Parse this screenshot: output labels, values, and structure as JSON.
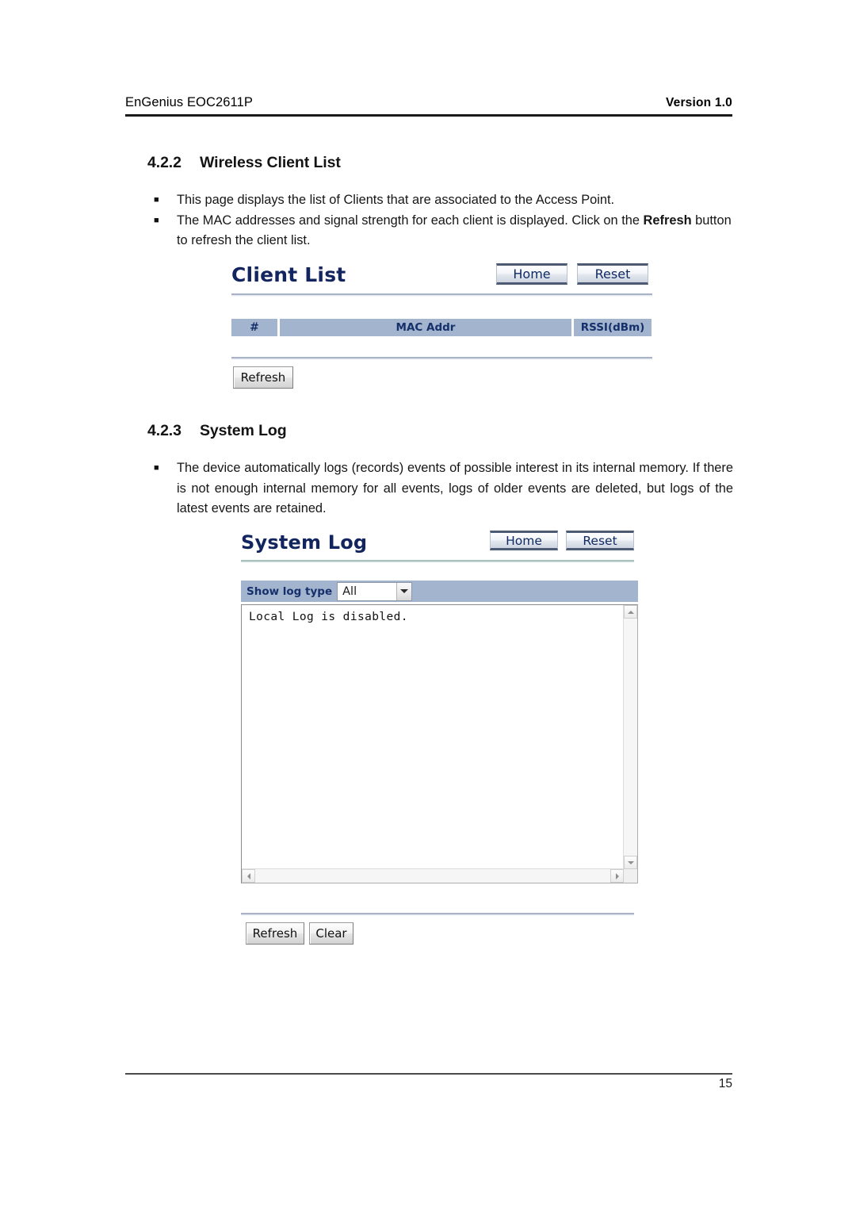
{
  "document": {
    "header_left": "EnGenius  EOC2611P",
    "header_right": "Version 1.0",
    "page_number": "15"
  },
  "sections": {
    "client_list": {
      "number": "4.2.2",
      "title": "Wireless Client List",
      "bullets": [
        "This page displays the list of Clients that are associated to the Access Point.",
        "The MAC addresses and signal strength for each client is displayed. Click on the "
      ],
      "bullet2_bold": "Refresh",
      "bullet2_tail": " button to refresh the client list."
    },
    "system_log": {
      "number": "4.2.3",
      "title": "System Log",
      "bullets": [
        "The device automatically logs (records) events of possible interest in its internal memory. If there is not enough internal memory for all events, logs of older events are deleted, but logs of the latest events are retained."
      ]
    }
  },
  "client_list_ui": {
    "title": "Client List",
    "home_button": "Home",
    "reset_button": "Reset",
    "table": {
      "columns": [
        "#",
        "MAC Addr",
        "RSSI(dBm)"
      ],
      "rows": []
    },
    "refresh_button": "Refresh"
  },
  "system_log_ui": {
    "title": "System Log",
    "home_button": "Home",
    "reset_button": "Reset",
    "log_type_label": "Show log type",
    "log_type_value": "All",
    "log_type_options": [
      "All"
    ],
    "log_content": "Local Log is disabled.",
    "refresh_button": "Refresh",
    "clear_button": "Clear"
  },
  "colors": {
    "ui_title": "#12255e",
    "table_header_bg": "#a3b4ce",
    "table_header_text": "#15306b",
    "nav_button_border": "#4c5a74"
  }
}
